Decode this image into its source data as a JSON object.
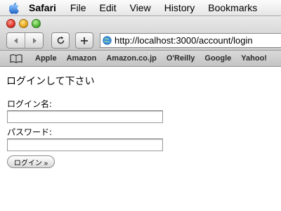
{
  "menubar": {
    "app": "Safari",
    "items": [
      "File",
      "Edit",
      "View",
      "History",
      "Bookmarks"
    ]
  },
  "toolbar": {
    "url": "http://localhost:3000/account/login"
  },
  "bookmarks": {
    "items": [
      "Apple",
      "Amazon",
      "Amazon.co.jp",
      "O'Reilly",
      "Google",
      "Yahoo!"
    ]
  },
  "page": {
    "heading": "ログインして下さい",
    "login_label": "ログイン名:",
    "login_value": "",
    "password_label": "パスワード:",
    "password_value": "",
    "submit_label": "ログイン »"
  },
  "colors": {
    "chrome_top": "#e9e9e9",
    "chrome_bottom": "#c9c9c9",
    "close": "#e0352b",
    "minimize": "#e9a61c",
    "zoom": "#4fb636"
  }
}
